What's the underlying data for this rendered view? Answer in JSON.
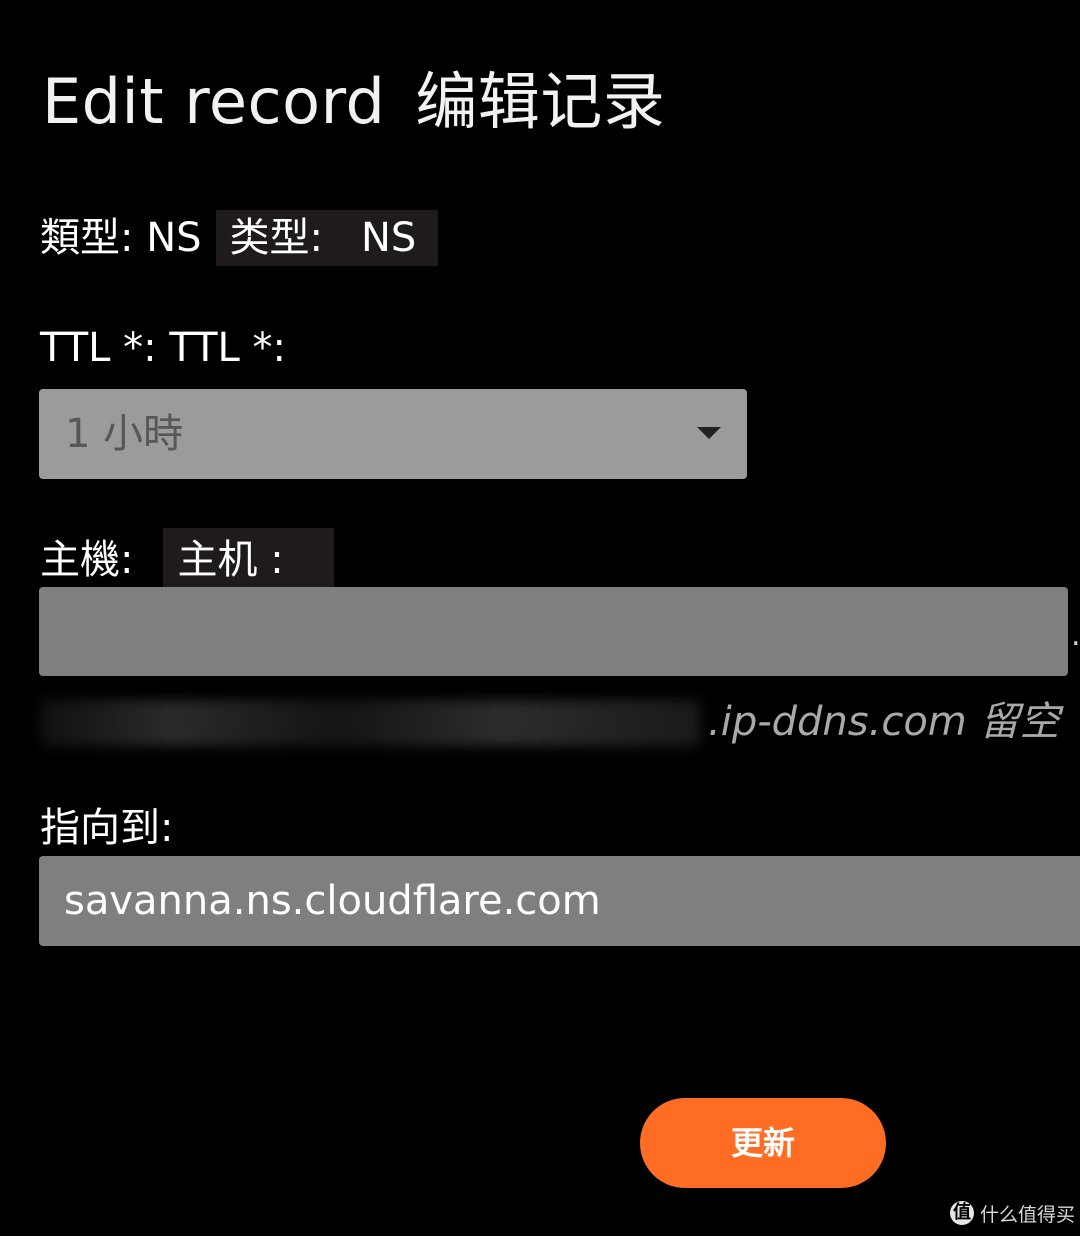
{
  "dialog": {
    "title_en": "Edit record",
    "title_cn": "编辑记录"
  },
  "type_field": {
    "label": "類型: NS",
    "translation_label": "类型:",
    "translation_value": "NS"
  },
  "ttl_field": {
    "label": "TTL *:",
    "translation": "TTL *:",
    "selected_value": "1 小時"
  },
  "host_field": {
    "label": "主機:",
    "translation": "主机 :",
    "value": "",
    "suffix_dot": ".",
    "hint_visible": ".ip-ddns.com 留空"
  },
  "target_field": {
    "label": "指向到:",
    "value": "savanna.ns.cloudflare.com"
  },
  "update_button": {
    "label": "更新",
    "color": "#ff6c23"
  },
  "watermark": {
    "logo_glyph": "值",
    "text": "什么值得买"
  }
}
